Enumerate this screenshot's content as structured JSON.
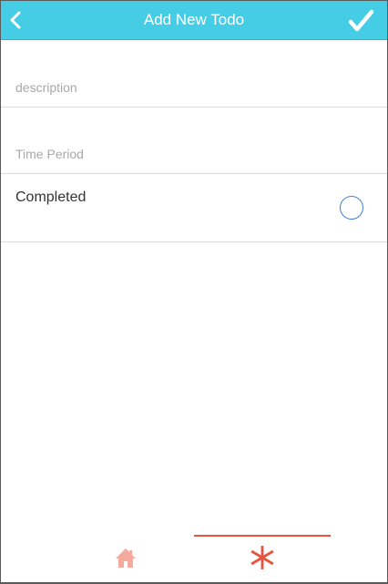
{
  "header": {
    "title": "Add New Todo",
    "back_icon": "chevron-left-icon",
    "confirm_icon": "check-icon"
  },
  "form": {
    "description": {
      "value": "",
      "placeholder": "description"
    },
    "time_period": {
      "value": "",
      "placeholder": "Time Period"
    },
    "completed": {
      "label": "Completed",
      "checked": false
    }
  },
  "tabbar": {
    "tabs": [
      {
        "name": "home",
        "icon": "home-icon",
        "active": false
      },
      {
        "name": "add",
        "icon": "asterisk-icon",
        "active": true
      }
    ]
  },
  "colors": {
    "header_bg": "#45cde6",
    "accent": "#e8533f",
    "inactive_icon": "#f4aa9d",
    "radio": "#3f7fd9"
  }
}
